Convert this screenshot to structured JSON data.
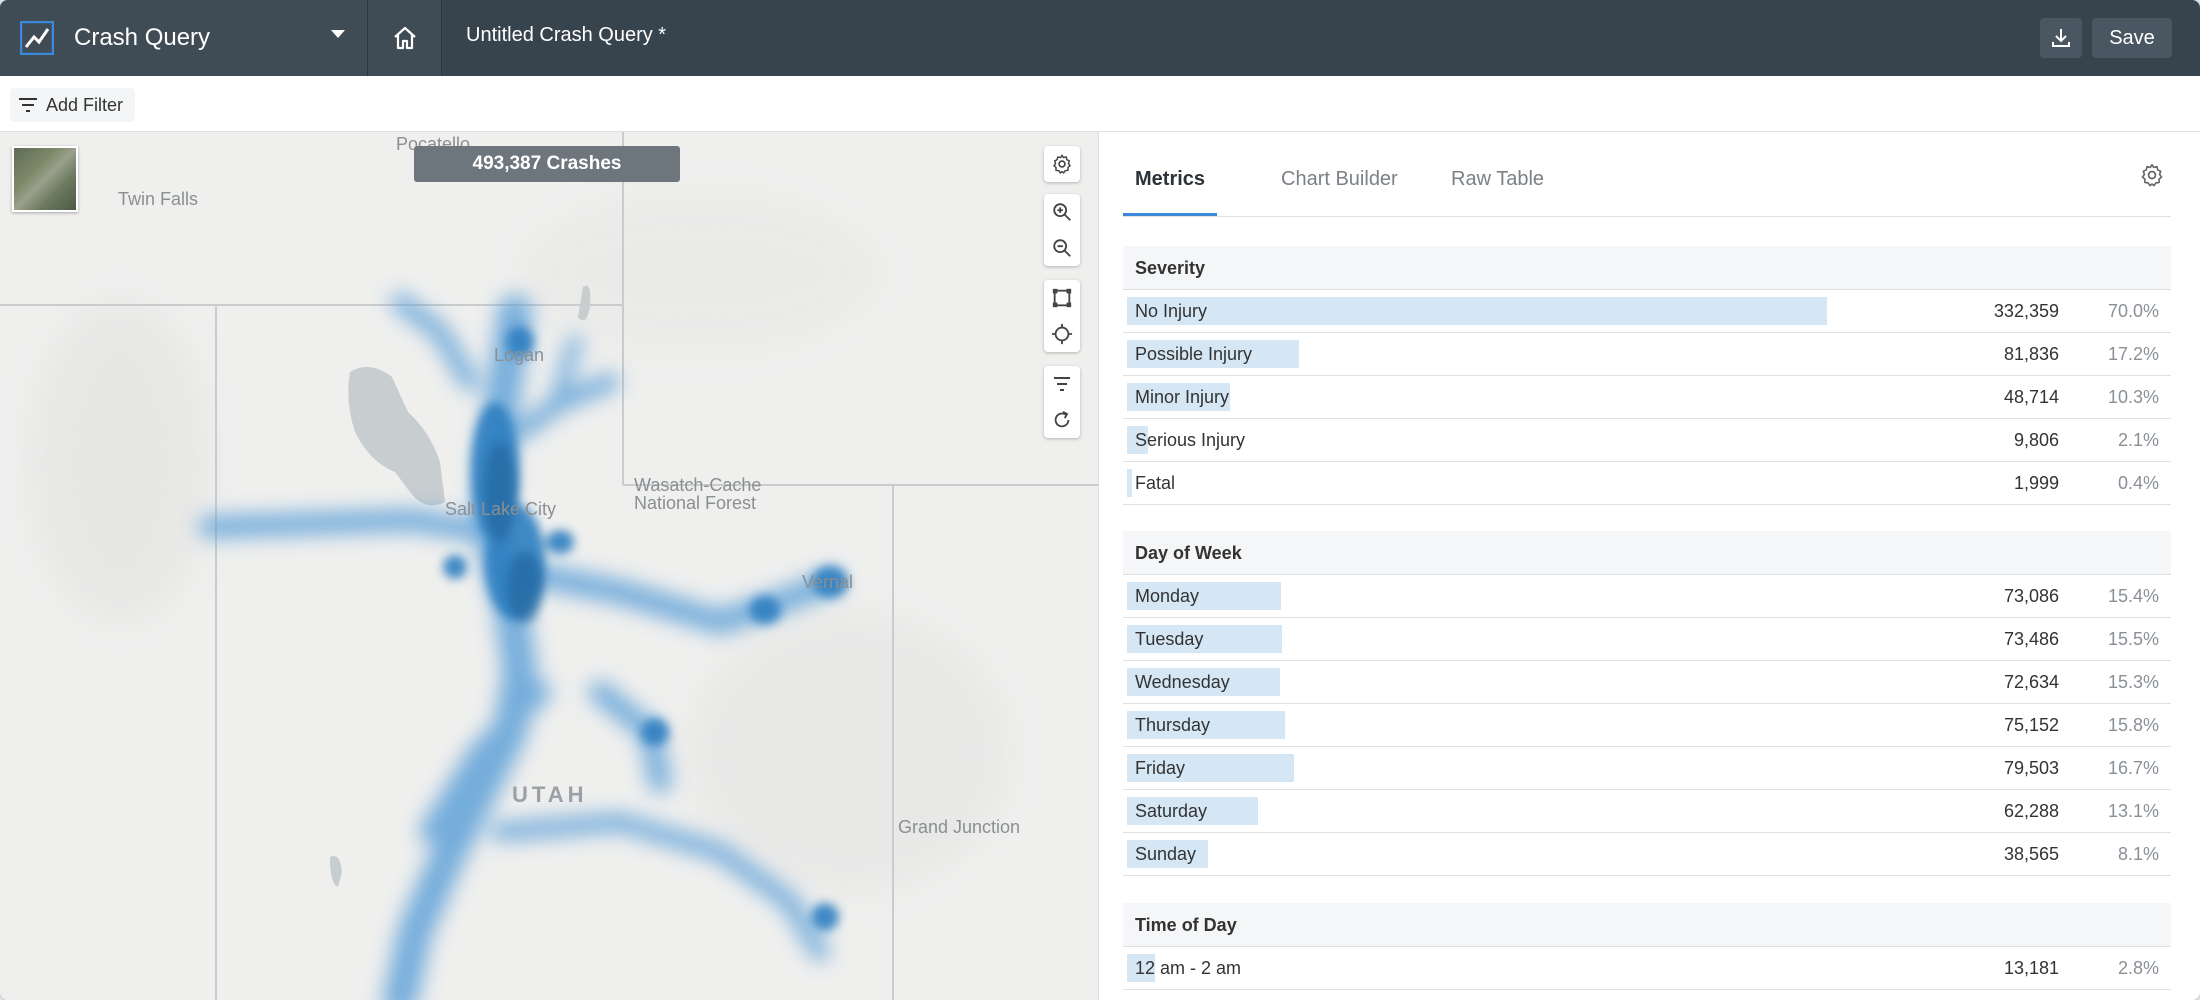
{
  "header": {
    "app_name": "Crash Query",
    "query_title": "Untitled Crash Query *",
    "save_label": "Save"
  },
  "toolbar": {
    "add_filter_label": "Add Filter"
  },
  "map": {
    "crash_count": "493,387 Crashes",
    "labels": {
      "pocatello": "Pocatello",
      "twin_falls": "Twin Falls",
      "logan": "Logan",
      "salt_lake": "Salt Lake City",
      "wasatch": "Wasatch-Cache",
      "national_forest": "National Forest",
      "vernal": "Vernal",
      "utah": "UTAH",
      "grand_junction": "Grand Junction"
    }
  },
  "panel": {
    "tabs": [
      {
        "label": "Metrics"
      },
      {
        "label": "Chart Builder"
      },
      {
        "label": "Raw Table"
      }
    ],
    "sections": {
      "severity": {
        "title": "Severity",
        "rows": [
          {
            "label": "No Injury",
            "count": "332,359",
            "pct": "70.0%",
            "value": 70.0
          },
          {
            "label": "Possible Injury",
            "count": "81,836",
            "pct": "17.2%",
            "value": 17.2
          },
          {
            "label": "Minor Injury",
            "count": "48,714",
            "pct": "10.3%",
            "value": 10.3
          },
          {
            "label": "Serious Injury",
            "count": "9,806",
            "pct": "2.1%",
            "value": 2.1
          },
          {
            "label": "Fatal",
            "count": "1,999",
            "pct": "0.4%",
            "value": 0.4
          }
        ]
      },
      "day_of_week": {
        "title": "Day of Week",
        "rows": [
          {
            "label": "Monday",
            "count": "73,086",
            "pct": "15.4%",
            "value": 15.4
          },
          {
            "label": "Tuesday",
            "count": "73,486",
            "pct": "15.5%",
            "value": 15.5
          },
          {
            "label": "Wednesday",
            "count": "72,634",
            "pct": "15.3%",
            "value": 15.3
          },
          {
            "label": "Thursday",
            "count": "75,152",
            "pct": "15.8%",
            "value": 15.8
          },
          {
            "label": "Friday",
            "count": "79,503",
            "pct": "16.7%",
            "value": 16.7
          },
          {
            "label": "Saturday",
            "count": "62,288",
            "pct": "13.1%",
            "value": 13.1
          },
          {
            "label": "Sunday",
            "count": "38,565",
            "pct": "8.1%",
            "value": 8.1
          }
        ]
      },
      "time_of_day": {
        "title": "Time of Day",
        "rows": [
          {
            "label": "12 am - 2 am",
            "count": "13,181",
            "pct": "2.8%",
            "value": 2.8
          }
        ]
      }
    }
  },
  "colors": {
    "header_bg": "#37434d",
    "accent": "#3b8ad9",
    "bar_fill": "#d5e6f4",
    "heat": "#2f7fc1"
  }
}
